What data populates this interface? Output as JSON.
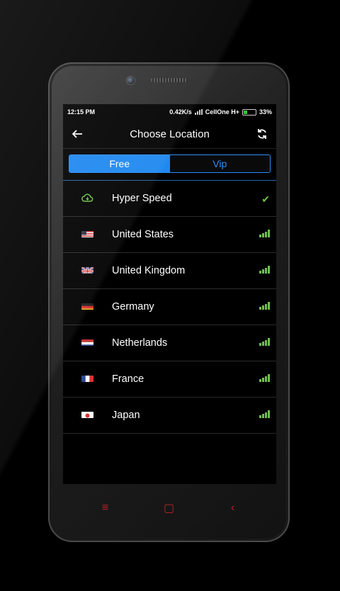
{
  "status": {
    "time": "12:15 PM",
    "speed": "0.42K/s",
    "carrier": "CellOne H+",
    "battery": "33%"
  },
  "appbar": {
    "title": "Choose Location",
    "back_icon": "arrow-left-icon",
    "refresh_icon": "refresh-icon"
  },
  "tabs": [
    {
      "label": "Free",
      "active": true
    },
    {
      "label": "Vip",
      "active": false
    }
  ],
  "locations": [
    {
      "name": "Hyper Speed",
      "icon": "cloud-speed-icon",
      "selected": true
    },
    {
      "name": "United States",
      "icon": "us-flag-icon",
      "signal": 4
    },
    {
      "name": "United Kingdom",
      "icon": "uk-flag-icon",
      "signal": 4
    },
    {
      "name": "Germany",
      "icon": "de-flag-icon",
      "signal": 4
    },
    {
      "name": "Netherlands",
      "icon": "nl-flag-icon",
      "signal": 4
    },
    {
      "name": "France",
      "icon": "fr-flag-icon",
      "signal": 4
    },
    {
      "name": "Japan",
      "icon": "jp-flag-icon",
      "signal": 4
    }
  ],
  "navbar": {
    "menu": "≡",
    "home": "▢",
    "back": "‹"
  },
  "colors": {
    "accent": "#1e88f0",
    "signal": "#6cc24a",
    "nav": "#c0202a"
  }
}
